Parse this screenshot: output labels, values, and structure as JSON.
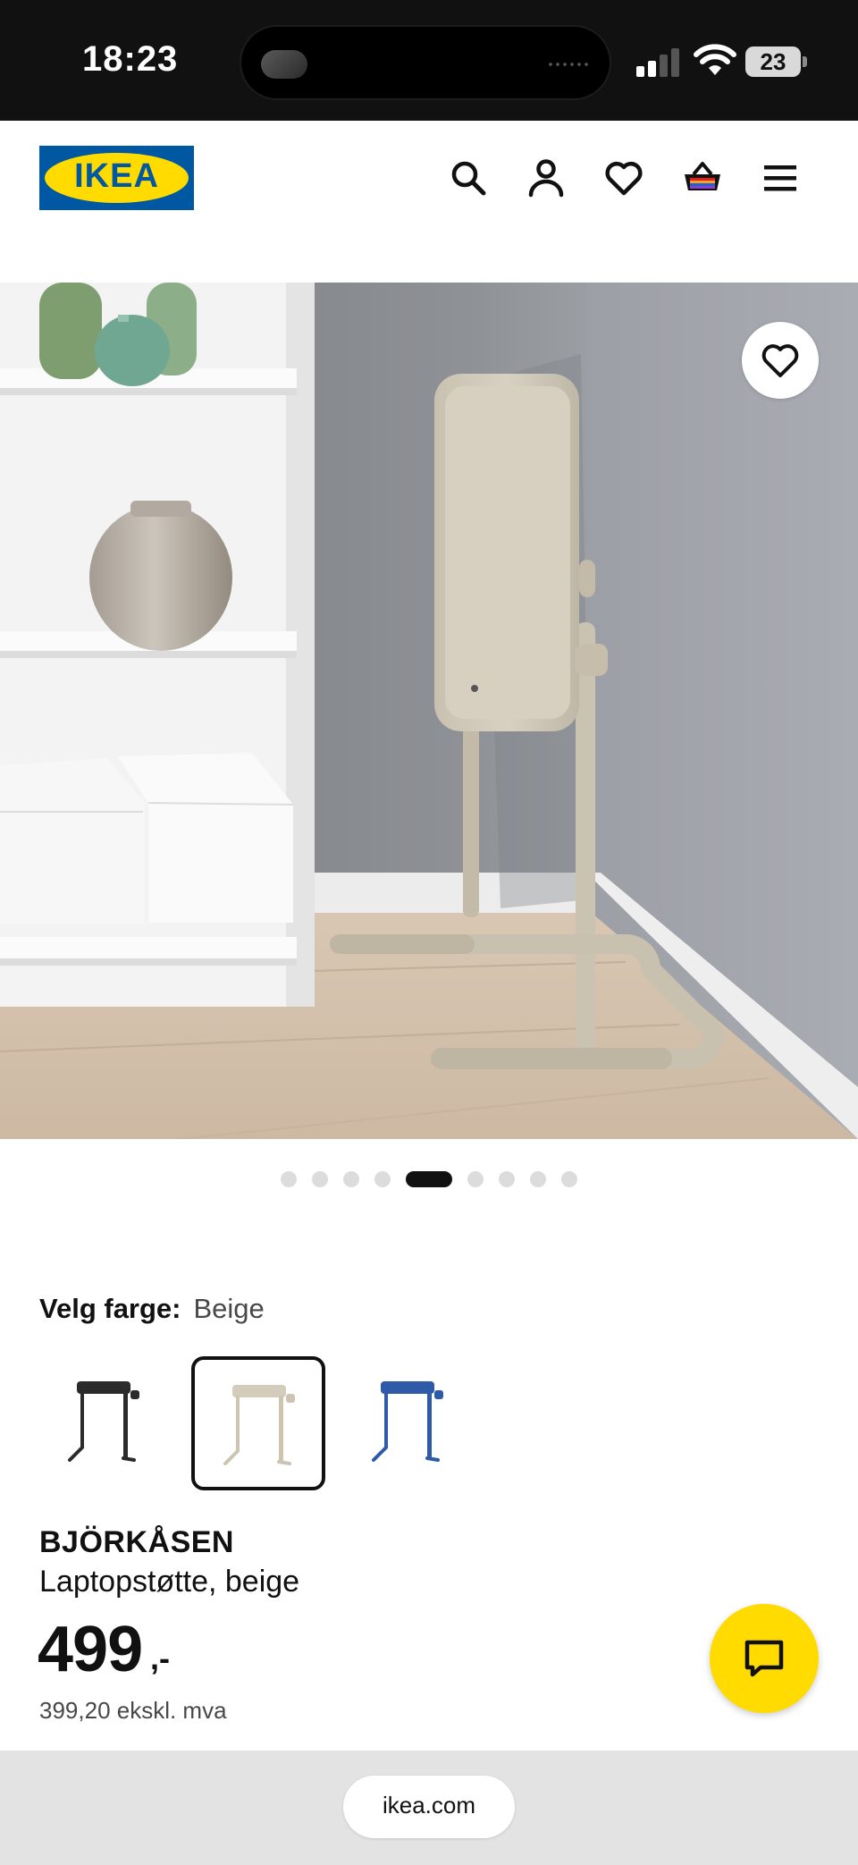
{
  "status_bar": {
    "time": "18:23",
    "battery": "23",
    "icons": [
      "signal-icon",
      "wifi-icon",
      "battery-icon"
    ]
  },
  "header": {
    "logo_text": "IKEA",
    "icons": [
      "search-icon",
      "account-icon",
      "wishlist-heart-icon",
      "cart-icon",
      "menu-icon"
    ]
  },
  "gallery": {
    "total_images": 9,
    "active_index": 5,
    "favorite_icon": "heart-icon"
  },
  "color_selection": {
    "label": "Velg farge:",
    "selected": "Beige",
    "swatches": [
      {
        "name": "black",
        "color": "#2b2b2b"
      },
      {
        "name": "beige",
        "color": "#cfc7b6"
      },
      {
        "name": "blue",
        "color": "#2f5aa8"
      }
    ]
  },
  "product": {
    "name": "BJÖRKÅSEN",
    "description": "Laptopstøtte, beige",
    "price": "499",
    "price_suffix": ",-",
    "price_ex_vat": "399,20 ekskl. mva"
  },
  "chat": {
    "icon": "chat-icon"
  },
  "browser": {
    "url": "ikea.com"
  },
  "colors": {
    "brand_blue": "#0058a3",
    "brand_yellow": "#ffdb00"
  }
}
